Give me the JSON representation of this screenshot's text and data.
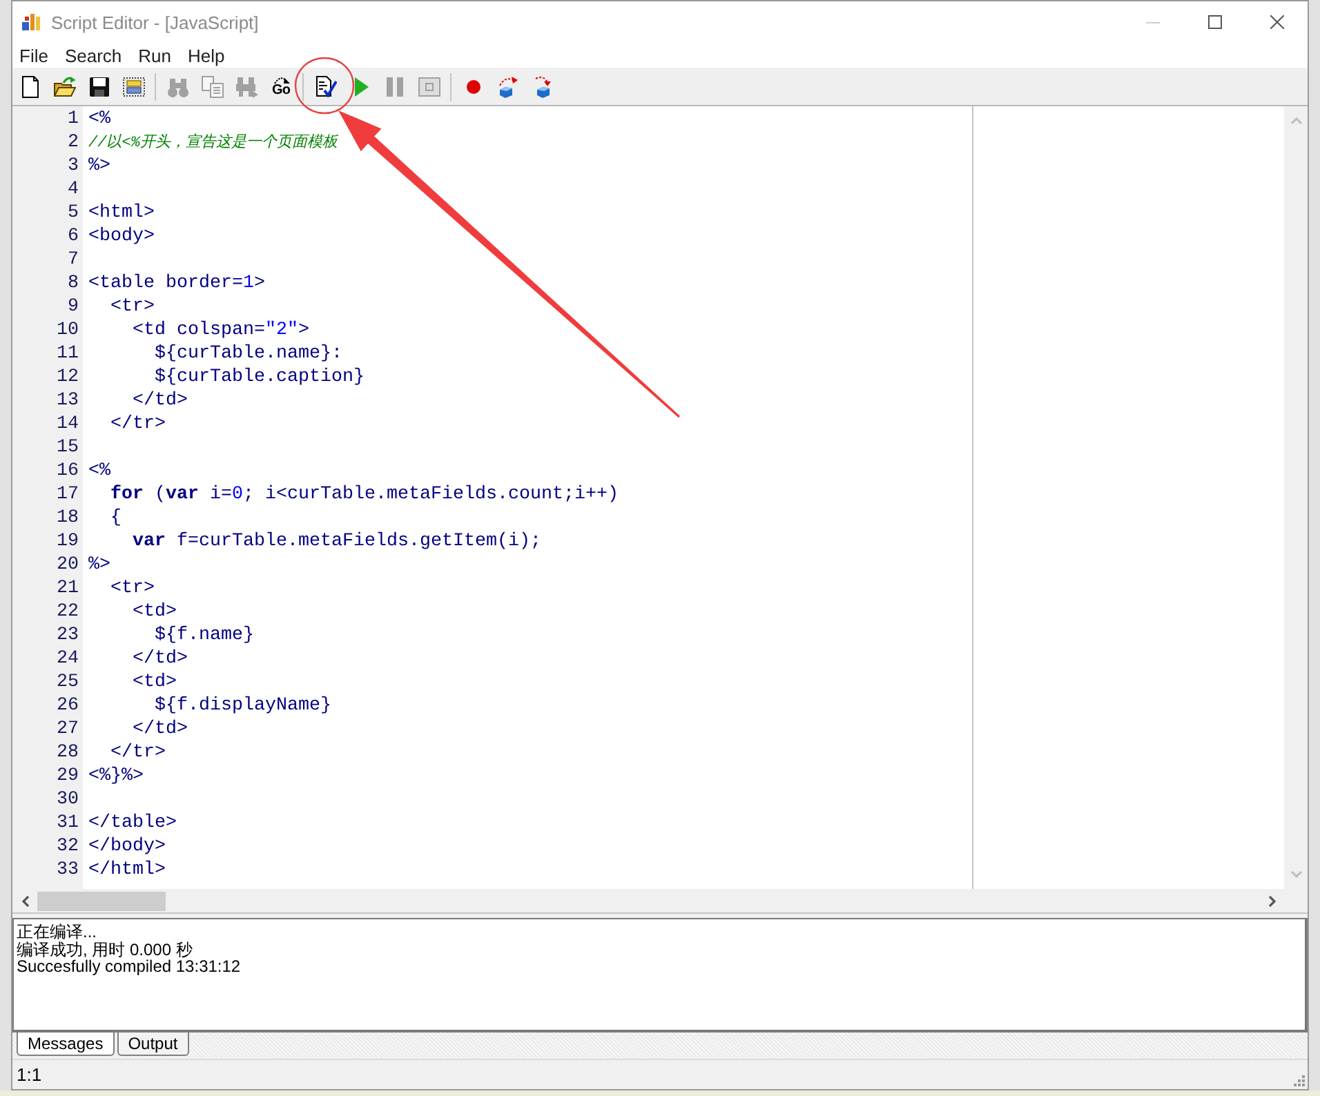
{
  "window": {
    "title": "Script Editor - [JavaScript]",
    "controls": [
      {
        "kind": "minimize",
        "disabled": true
      },
      {
        "kind": "maximize",
        "disabled": false
      },
      {
        "kind": "close",
        "disabled": false
      }
    ]
  },
  "menu": [
    "File",
    "Search",
    "Run",
    "Help"
  ],
  "toolbar": {
    "groups": [
      [
        {
          "kind": "new",
          "disabled": false
        },
        {
          "kind": "open",
          "disabled": false
        },
        {
          "kind": "save",
          "disabled": false
        },
        {
          "kind": "preview",
          "disabled": false
        }
      ],
      [
        {
          "kind": "find",
          "disabled": true
        },
        {
          "kind": "replace",
          "disabled": true
        },
        {
          "kind": "find_next",
          "disabled": true
        },
        {
          "kind": "goto",
          "label": "Go",
          "disabled": false
        }
      ],
      [
        {
          "kind": "compile",
          "disabled": false
        },
        {
          "kind": "run",
          "disabled": false
        },
        {
          "kind": "pause",
          "disabled": true
        },
        {
          "kind": "stop",
          "disabled": true
        }
      ],
      [
        {
          "kind": "breakpoint",
          "disabled": false
        },
        {
          "kind": "step_into",
          "disabled": false
        },
        {
          "kind": "step_over",
          "disabled": false
        }
      ]
    ]
  },
  "editor": {
    "lines": [
      {
        "number": "1",
        "tokens": [
          {
            "kind": "plain",
            "text": "<%"
          }
        ]
      },
      {
        "number": "2",
        "tokens": [
          {
            "kind": "comment",
            "text": "//以<%开头，宣告这是一个页面模板"
          }
        ]
      },
      {
        "number": "3",
        "tokens": [
          {
            "kind": "plain",
            "text": "%>"
          }
        ]
      },
      {
        "number": "4"
      },
      {
        "number": "5",
        "tokens": [
          {
            "kind": "plain",
            "text": "<html>"
          }
        ]
      },
      {
        "number": "6",
        "tokens": [
          {
            "kind": "plain",
            "text": "<body>"
          }
        ]
      },
      {
        "number": "7"
      },
      {
        "number": "8",
        "tokens": [
          {
            "kind": "plain",
            "text": "<table border="
          },
          {
            "kind": "number",
            "text": "1"
          },
          {
            "kind": "plain",
            "text": ">"
          }
        ]
      },
      {
        "number": "9",
        "tokens": [
          {
            "kind": "plain",
            "text": "  <tr>"
          }
        ]
      },
      {
        "number": "10",
        "tokens": [
          {
            "kind": "plain",
            "text": "    <td colspan="
          },
          {
            "kind": "string",
            "text": "\"2\""
          },
          {
            "kind": "plain",
            "text": ">"
          }
        ]
      },
      {
        "number": "11",
        "tokens": [
          {
            "kind": "plain",
            "text": "      ${curTable.name}:"
          }
        ]
      },
      {
        "number": "12",
        "tokens": [
          {
            "kind": "plain",
            "text": "      ${curTable.caption}"
          }
        ]
      },
      {
        "number": "13",
        "tokens": [
          {
            "kind": "plain",
            "text": "    </td>"
          }
        ]
      },
      {
        "number": "14",
        "tokens": [
          {
            "kind": "plain",
            "text": "  </tr>"
          }
        ]
      },
      {
        "number": "15"
      },
      {
        "number": "16",
        "tokens": [
          {
            "kind": "plain",
            "text": "<%"
          }
        ]
      },
      {
        "number": "17",
        "tokens": [
          {
            "kind": "keyword",
            "text": "  for"
          },
          {
            "kind": "plain",
            "text": " ("
          },
          {
            "kind": "keyword",
            "text": "var"
          },
          {
            "kind": "plain",
            "text": " i="
          },
          {
            "kind": "number",
            "text": "0"
          },
          {
            "kind": "plain",
            "text": "; i<curTable.metaFields.count;i++)"
          }
        ]
      },
      {
        "number": "18",
        "tokens": [
          {
            "kind": "plain",
            "text": "  {"
          }
        ]
      },
      {
        "number": "19",
        "tokens": [
          {
            "kind": "keyword",
            "text": "    var"
          },
          {
            "kind": "plain",
            "text": " f=curTable.metaFields.getItem(i);"
          }
        ]
      },
      {
        "number": "20",
        "tokens": [
          {
            "kind": "plain",
            "text": "%>"
          }
        ]
      },
      {
        "number": "21",
        "tokens": [
          {
            "kind": "plain",
            "text": "  <tr>"
          }
        ]
      },
      {
        "number": "22",
        "tokens": [
          {
            "kind": "plain",
            "text": "    <td>"
          }
        ]
      },
      {
        "number": "23",
        "tokens": [
          {
            "kind": "plain",
            "text": "      ${f.name}"
          }
        ]
      },
      {
        "number": "24",
        "tokens": [
          {
            "kind": "plain",
            "text": "    </td>"
          }
        ]
      },
      {
        "number": "25",
        "tokens": [
          {
            "kind": "plain",
            "text": "    <td>"
          }
        ]
      },
      {
        "number": "26",
        "tokens": [
          {
            "kind": "plain",
            "text": "      ${f.displayName}"
          }
        ]
      },
      {
        "number": "27",
        "tokens": [
          {
            "kind": "plain",
            "text": "    </td>"
          }
        ]
      },
      {
        "number": "28",
        "tokens": [
          {
            "kind": "plain",
            "text": "  </tr>"
          }
        ]
      },
      {
        "number": "29",
        "tokens": [
          {
            "kind": "plain",
            "text": "<%}%>"
          }
        ]
      },
      {
        "number": "30"
      },
      {
        "number": "31",
        "tokens": [
          {
            "kind": "plain",
            "text": "</table>"
          }
        ]
      },
      {
        "number": "32",
        "tokens": [
          {
            "kind": "plain",
            "text": "</body>"
          }
        ]
      },
      {
        "number": "33",
        "tokens": [
          {
            "kind": "plain",
            "text": "</html>"
          }
        ]
      }
    ]
  },
  "messages": [
    "正在编译...",
    "编译成功, 用时 0.000 秒",
    "Succesfully compiled 13:31:12"
  ],
  "tabs": [
    {
      "label": "Messages",
      "selected": true
    },
    {
      "label": "Output",
      "selected": false
    }
  ],
  "status_bar": {
    "position": "1:1"
  },
  "annotation": {
    "kind": "circled_arrow"
  }
}
